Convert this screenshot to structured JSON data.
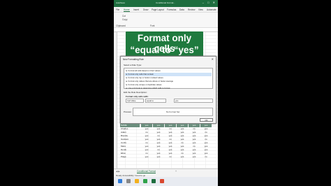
{
  "window": {
    "autosave": "AutoSave",
    "title": "Conditional Format...",
    "controls": "– □ ✕"
  },
  "ribbon_tabs": [
    "File",
    "Home",
    "Insert",
    "Draw",
    "Page Layout",
    "Formulas",
    "Data",
    "Review",
    "View",
    "Automate"
  ],
  "ribbon": {
    "cut": "Cut",
    "copy": "Copy",
    "clipboard": "Clipboard",
    "font": "Font"
  },
  "callout": {
    "line1": "Format only cells",
    "line2": "“equal to “yes”"
  },
  "dialog": {
    "title": "New Formatting Rule",
    "select_rule_type_label": "Select a Rule Type:",
    "rule_types": [
      "► Format all cells based on their values",
      "► Format only cells that contain",
      "► Format only top or bottom ranked values",
      "► Format only values that are above or below average",
      "► Format only unique or duplicate values",
      "► Use a formula to determine which cells to format"
    ],
    "edit_label": "Edit the Rule Description:",
    "format_only_cells_with": "Format only cells with:",
    "condition_1": "Cell Value",
    "condition_2": "equal to",
    "condition_value": "yes",
    "preview_label": "Preview:",
    "preview_text": "No Format Set",
    "ok_label": "OK"
  },
  "table": {
    "header": [
      "NAME",
      "yes",
      "yes",
      "yes",
      "yes",
      "yes",
      "yes"
    ],
    "rows": [
      [
        "Charles",
        "yes",
        "yes",
        "no",
        "yes",
        "no",
        "yes"
      ],
      [
        "Adam",
        "no",
        "yes",
        "yes",
        "yes",
        "yes",
        "no"
      ],
      [
        "Brenda",
        "yes",
        "no",
        "yes",
        "yes",
        "yes",
        "yes"
      ],
      [
        "Gustavo",
        "yes",
        "yes",
        "no",
        "yes",
        "yes",
        "no"
      ],
      [
        "Curtis",
        "no",
        "yes",
        "yes",
        "no",
        "yes",
        "yes"
      ],
      [
        "Mara",
        "yes",
        "yes",
        "yes",
        "yes",
        "no",
        "yes"
      ],
      [
        "Derek",
        "yes",
        "no",
        "yes",
        "yes",
        "yes",
        "yes"
      ],
      [
        "Elisa",
        "no",
        "yes",
        "yes",
        "no",
        "yes",
        "yes"
      ],
      [
        "Paige",
        "yes",
        "yes",
        "no",
        "yes",
        "yes",
        "no"
      ]
    ]
  },
  "sheet_tab": "Conditional Format",
  "status": "Ready   Accessibility: Good to go",
  "colors": {
    "excel_green": "#1e6e3f",
    "callout_green": "#1f7a3e",
    "selection_blue": "#cfe3f8"
  }
}
